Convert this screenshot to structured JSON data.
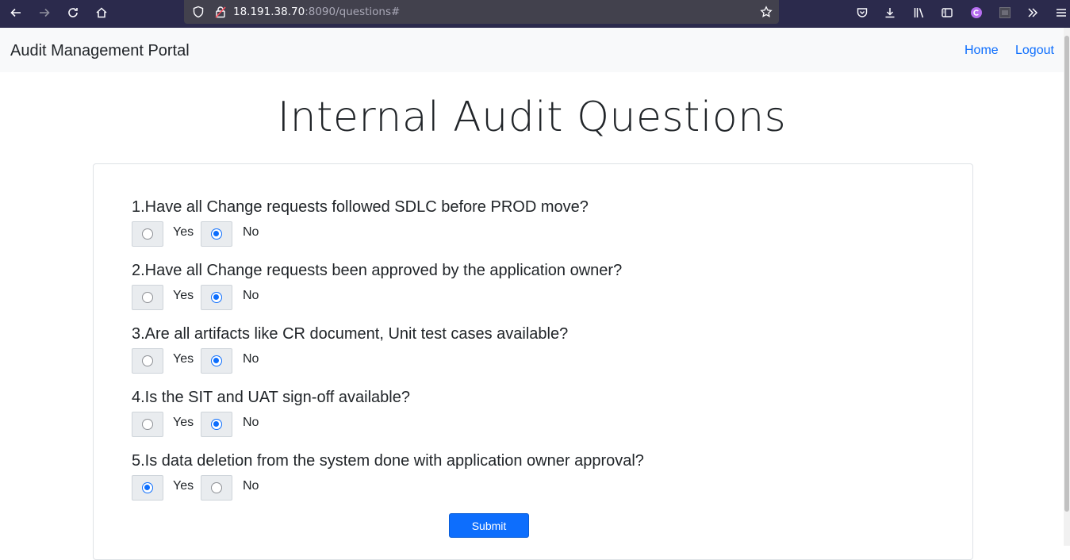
{
  "browser": {
    "url_host": "18.191.38.70",
    "url_rest": ":8090/questions#"
  },
  "navbar": {
    "brand": "Audit Management Portal",
    "links": [
      "Home",
      "Logout"
    ]
  },
  "page": {
    "title": "Internal Audit Questions"
  },
  "questions": [
    {
      "text": "1.Have all Change requests followed SDLC before PROD move?",
      "yes_label": "Yes",
      "no_label": "No",
      "selected": "No"
    },
    {
      "text": "2.Have all Change requests been approved by the application owner?",
      "yes_label": "Yes",
      "no_label": "No",
      "selected": "No"
    },
    {
      "text": "3.Are all artifacts like CR document, Unit test cases available?",
      "yes_label": "Yes",
      "no_label": "No",
      "selected": "No"
    },
    {
      "text": "4.Is the SIT and UAT sign-off available?",
      "yes_label": "Yes",
      "no_label": "No",
      "selected": "No"
    },
    {
      "text": "5.Is data deletion from the system done with application owner approval?",
      "yes_label": "Yes",
      "no_label": "No",
      "selected": "Yes"
    }
  ],
  "form": {
    "submit_label": "Submit"
  },
  "colors": {
    "browser_chrome": "#2b2a4c",
    "accent": "#0d6efd",
    "navbar_bg": "#f8f9fa"
  }
}
